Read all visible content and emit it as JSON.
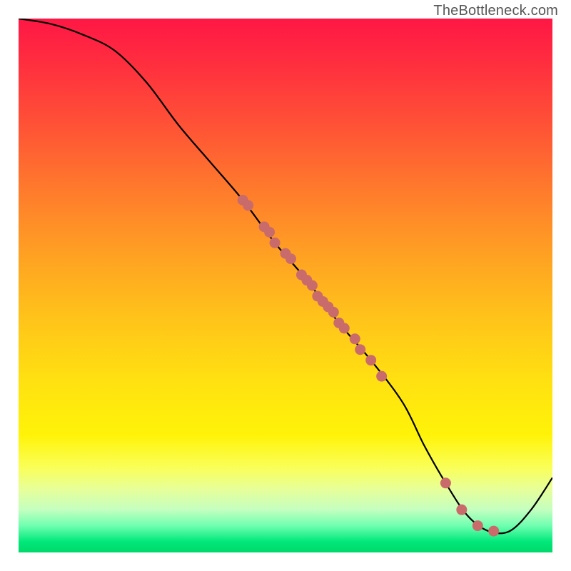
{
  "watermark": {
    "text": "TheBottleneck.com"
  },
  "chart_data": {
    "type": "line",
    "title": "",
    "xlabel": "",
    "ylabel": "",
    "xlim": [
      0,
      100
    ],
    "ylim": [
      0,
      100
    ],
    "gradient_stops": [
      {
        "pct": 0,
        "color": "#ff1745"
      },
      {
        "pct": 8,
        "color": "#ff2d3f"
      },
      {
        "pct": 20,
        "color": "#ff5236"
      },
      {
        "pct": 32,
        "color": "#ff7a2c"
      },
      {
        "pct": 44,
        "color": "#ffa023"
      },
      {
        "pct": 56,
        "color": "#ffc31a"
      },
      {
        "pct": 68,
        "color": "#ffe111"
      },
      {
        "pct": 78,
        "color": "#fff308"
      },
      {
        "pct": 84,
        "color": "#faff57"
      },
      {
        "pct": 88,
        "color": "#e8ff97"
      },
      {
        "pct": 92,
        "color": "#c4ffc0"
      },
      {
        "pct": 95,
        "color": "#6fffb0"
      },
      {
        "pct": 98,
        "color": "#00e87a"
      },
      {
        "pct": 100,
        "color": "#00d86b"
      }
    ],
    "series": [
      {
        "name": "bottleneck-curve",
        "color": "#000000",
        "x": [
          0,
          6,
          12,
          18,
          24,
          30,
          36,
          42,
          48,
          54,
          60,
          66,
          72,
          76,
          80,
          84,
          88,
          92,
          96,
          100
        ],
        "y": [
          100,
          99,
          97,
          94,
          88,
          80,
          73,
          66,
          58,
          51,
          43,
          36,
          28,
          20,
          13,
          7,
          4,
          4,
          8,
          14
        ]
      }
    ],
    "marker_series": {
      "name": "data-points",
      "color": "#c96b6b",
      "points": [
        {
          "x": 42,
          "y": 66
        },
        {
          "x": 43,
          "y": 65
        },
        {
          "x": 46,
          "y": 61
        },
        {
          "x": 47,
          "y": 60
        },
        {
          "x": 48,
          "y": 58
        },
        {
          "x": 50,
          "y": 56
        },
        {
          "x": 51,
          "y": 55
        },
        {
          "x": 53,
          "y": 52
        },
        {
          "x": 54,
          "y": 51
        },
        {
          "x": 55,
          "y": 50
        },
        {
          "x": 56,
          "y": 48
        },
        {
          "x": 57,
          "y": 47
        },
        {
          "x": 58,
          "y": 46
        },
        {
          "x": 59,
          "y": 45
        },
        {
          "x": 60,
          "y": 43
        },
        {
          "x": 61,
          "y": 42
        },
        {
          "x": 63,
          "y": 40
        },
        {
          "x": 64,
          "y": 38
        },
        {
          "x": 66,
          "y": 36
        },
        {
          "x": 68,
          "y": 33
        },
        {
          "x": 80,
          "y": 13
        },
        {
          "x": 83,
          "y": 8
        },
        {
          "x": 86,
          "y": 5
        },
        {
          "x": 89,
          "y": 4
        }
      ]
    }
  }
}
